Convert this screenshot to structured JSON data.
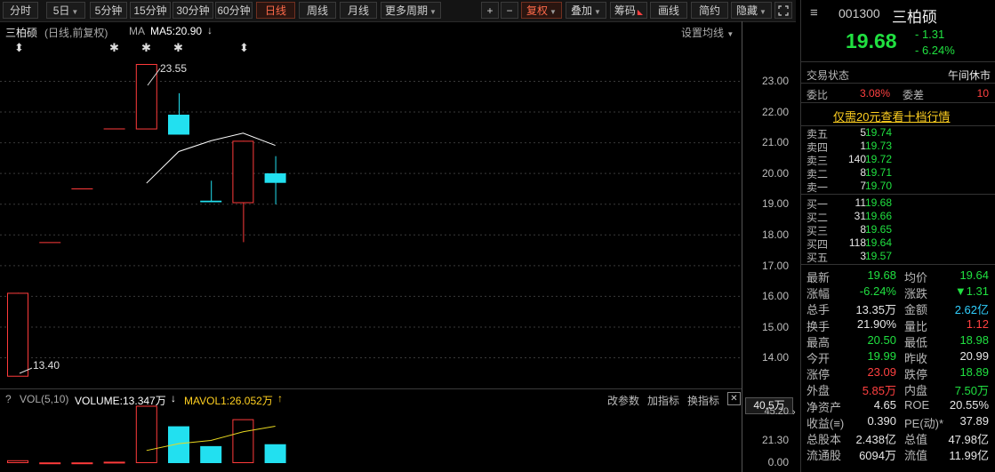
{
  "toolbar": {
    "periods": [
      "分时",
      "5日",
      "5分钟",
      "15分钟",
      "30分钟",
      "60分钟",
      "日线",
      "周线",
      "月线",
      "更多周期"
    ],
    "active_period": "日线",
    "plus": "+",
    "minus": "−",
    "fuquan": "复权",
    "diejia": "叠加",
    "chouma": "筹码",
    "huaxian": "画线",
    "jianyue": "简约",
    "yincang": "隐藏"
  },
  "chart": {
    "stock_name": "三柏硕",
    "mode": "(日线,前复权)",
    "ma_label": "MA",
    "ma5": "MA5:20.90",
    "settings": "设置均线",
    "high_label": "23.55",
    "low_label": "13.40",
    "price_axis": [
      "23.00",
      "22.00",
      "21.00",
      "20.00",
      "19.00",
      "18.00",
      "17.00",
      "16.00",
      "15.00",
      "14.00"
    ],
    "vol_title": "VOL(5,10)",
    "volume": "VOLUME:13.347万",
    "mavol1": "MAVOL1:26.052万",
    "vol_buttons": [
      "改参数",
      "加指标",
      "换指标"
    ],
    "vol_axis": [
      "45.20",
      "21.30",
      "0.00"
    ],
    "vol_hover": "40.5万",
    "colors": {
      "up": "#ff3b3b",
      "down": "#22e0f0",
      "ma": "#ffffff",
      "mavol": "#e8d820"
    }
  },
  "chart_data": {
    "type": "candlestick",
    "price_range": [
      13.4,
      23.55
    ],
    "candles": [
      {
        "o": 13.4,
        "c": 16.1,
        "h": 16.1,
        "l": 13.4,
        "vol": 2
      },
      {
        "o": 17.75,
        "c": 17.75,
        "h": 17.75,
        "l": 17.75,
        "vol": 0.5
      },
      {
        "o": 19.5,
        "c": 19.5,
        "h": 19.5,
        "l": 19.5,
        "vol": 0.5
      },
      {
        "o": 21.45,
        "c": 21.45,
        "h": 21.45,
        "l": 21.45,
        "vol": 1
      },
      {
        "o": 21.45,
        "c": 23.55,
        "h": 23.55,
        "l": 21.45,
        "vol": 40.5
      },
      {
        "o": 21.9,
        "c": 21.25,
        "h": 22.6,
        "l": 21.25,
        "vol": 26
      },
      {
        "o": 19.1,
        "c": 19.05,
        "h": 19.75,
        "l": 19.05,
        "vol": 12
      },
      {
        "o": 19.05,
        "c": 21.05,
        "h": 21.05,
        "l": 17.75,
        "vol": 31
      },
      {
        "o": 19.99,
        "c": 19.68,
        "h": 20.55,
        "l": 18.98,
        "vol": 13.347
      }
    ],
    "ma5": [
      null,
      null,
      null,
      null,
      19.67,
      20.7,
      21.05,
      21.3,
      20.9
    ],
    "mavol": [
      null,
      null,
      null,
      null,
      8.9,
      13.7,
      16,
      22.1,
      26.05
    ],
    "vol_range": [
      0,
      45.2
    ]
  },
  "panel": {
    "code": "001300",
    "name": "三柏硕",
    "price": "19.68",
    "change": "- 1.31",
    "change_pct": "- 6.24%",
    "status_label": "交易状态",
    "status_value": "午间休市",
    "weibi_label": "委比",
    "weibi_value": "3.08%",
    "weicha_label": "委差",
    "weicha_value": "10",
    "promo": "仅需20元查看十档行情",
    "asks": [
      {
        "label": "卖五",
        "price": "19.74",
        "vol": "5"
      },
      {
        "label": "卖四",
        "price": "19.73",
        "vol": "1"
      },
      {
        "label": "卖三",
        "price": "19.72",
        "vol": "140"
      },
      {
        "label": "卖二",
        "price": "19.71",
        "vol": "8"
      },
      {
        "label": "卖一",
        "price": "19.70",
        "vol": "7"
      }
    ],
    "bids": [
      {
        "label": "买一",
        "price": "19.68",
        "vol": "11"
      },
      {
        "label": "买二",
        "price": "19.66",
        "vol": "31"
      },
      {
        "label": "买三",
        "price": "19.65",
        "vol": "8"
      },
      {
        "label": "买四",
        "price": "19.64",
        "vol": "118"
      },
      {
        "label": "买五",
        "price": "19.57",
        "vol": "3"
      }
    ],
    "stats": [
      {
        "l1": "最新",
        "v1": "19.68",
        "c1": "green",
        "l2": "均价",
        "v2": "19.64",
        "c2": "green"
      },
      {
        "l1": "涨幅",
        "v1": "-6.24%",
        "c1": "green",
        "l2": "涨跌",
        "v2": "▼1.31",
        "c2": "green"
      },
      {
        "l1": "总手",
        "v1": "13.35万",
        "c1": "white",
        "l2": "金额",
        "v2": "2.62亿",
        "c2": "cyan"
      },
      {
        "l1": "换手",
        "v1": "21.90%",
        "c1": "white",
        "l2": "量比",
        "v2": "1.12",
        "c2": "red"
      },
      {
        "l1": "最高",
        "v1": "20.50",
        "c1": "green",
        "l2": "最低",
        "v2": "18.98",
        "c2": "green"
      },
      {
        "l1": "今开",
        "v1": "19.99",
        "c1": "green",
        "l2": "昨收",
        "v2": "20.99",
        "c2": "white"
      },
      {
        "l1": "涨停",
        "v1": "23.09",
        "c1": "red",
        "l2": "跌停",
        "v2": "18.89",
        "c2": "green"
      },
      {
        "l1": "外盘",
        "v1": "5.85万",
        "c1": "red",
        "l2": "内盘",
        "v2": "7.50万",
        "c2": "green"
      },
      {
        "l1": "净资产",
        "v1": "4.65",
        "c1": "white",
        "l2": "ROE",
        "v2": "20.55%",
        "c2": "white"
      },
      {
        "l1": "收益(≡)",
        "v1": "0.390",
        "c1": "white",
        "l2": "PE(动)*",
        "v2": "37.89",
        "c2": "white"
      },
      {
        "l1": "总股本",
        "v1": "2.438亿",
        "c1": "white",
        "l2": "总值",
        "v2": "47.98亿",
        "c2": "white"
      },
      {
        "l1": "流通股",
        "v1": "6094万",
        "c1": "white",
        "l2": "流值",
        "v2": "11.99亿",
        "c2": "white"
      }
    ]
  }
}
